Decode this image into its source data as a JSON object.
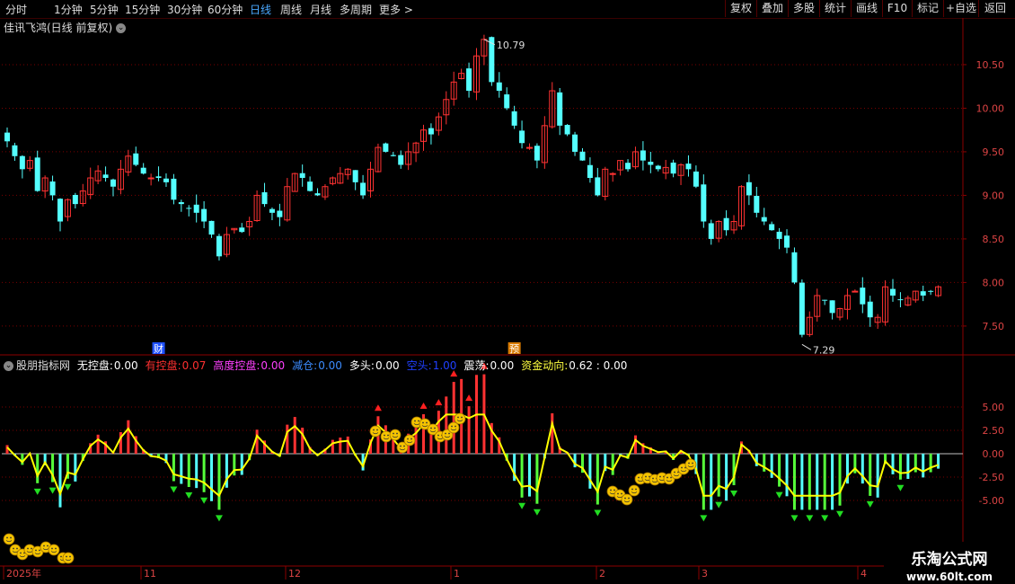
{
  "toolbar": {
    "periods": [
      "分时",
      "1分钟",
      "5分钟",
      "15分钟",
      "30分钟",
      "60分钟",
      "日线",
      "周线",
      "月线",
      "多周期",
      "更多 >"
    ],
    "active_period": "日线",
    "buttons": [
      "复权",
      "叠加",
      "多股",
      "统计",
      "画线",
      "F10",
      "标记",
      "+自选",
      "返回"
    ]
  },
  "main_chart": {
    "title": "佳讯飞鸿(日线 前复权)",
    "high_label": "10.79",
    "low_label": "7.29",
    "price_ticks": [
      "10.50",
      "10.00",
      "9.50",
      "9.00",
      "8.50",
      "8.00",
      "7.50"
    ],
    "markers": {
      "cai": "财",
      "yu": "预"
    }
  },
  "indicator": {
    "name": "股朋指标网",
    "items": [
      {
        "label": "无控盘",
        "value": "0.00",
        "color": "#ffffff"
      },
      {
        "label": "有控盘",
        "value": "0.07",
        "color": "#ff3030"
      },
      {
        "label": "高度控盘",
        "value": "0.00",
        "color": "#ff40ff"
      },
      {
        "label": "减仓",
        "value": "0.00",
        "color": "#3c8cff"
      },
      {
        "label": "多头",
        "value": "0.00",
        "color": "#ffffff"
      },
      {
        "label": "空头",
        "value": "1.00",
        "color": "#2040ff"
      },
      {
        "label": "震荡",
        "value": "0.00",
        "color": "#ffffff"
      },
      {
        "label": "资金动向",
        "value": "0.62 : 0.00",
        "color": "#ffff40"
      }
    ],
    "ticks": [
      "5.00",
      "2.50",
      "0.00",
      "-2.50",
      "-5.00"
    ]
  },
  "time_axis": [
    "2025年",
    "11",
    "12",
    "1",
    "2",
    "3",
    "4"
  ],
  "logo": {
    "line1": "乐淘公式网",
    "line2": "www.60lt.com"
  },
  "colors": {
    "up": "#ff3232",
    "down": "#54ffff",
    "grid": "#8b0000",
    "text": "#dddddd",
    "line": "#ffff00"
  },
  "chart_data": {
    "type": "candlestick",
    "y_range": [
      7.2,
      10.85
    ],
    "closes": [
      9.62,
      9.45,
      9.3,
      9.4,
      9.05,
      9.2,
      9.0,
      8.7,
      8.95,
      8.9,
      9.05,
      9.2,
      9.28,
      9.2,
      9.1,
      9.3,
      9.45,
      9.35,
      9.25,
      9.2,
      9.2,
      9.15,
      8.95,
      8.9,
      8.85,
      8.8,
      8.7,
      8.55,
      8.3,
      8.55,
      8.62,
      8.58,
      8.7,
      9.0,
      8.9,
      8.8,
      8.75,
      9.1,
      9.25,
      9.2,
      9.05,
      9.0,
      9.1,
      9.2,
      9.25,
      9.3,
      9.15,
      9.0,
      9.3,
      9.55,
      9.5,
      9.45,
      9.35,
      9.5,
      9.6,
      9.75,
      9.7,
      9.9,
      10.1,
      10.3,
      10.4,
      10.2,
      10.6,
      10.79,
      10.3,
      10.2,
      10.0,
      9.8,
      9.6,
      9.55,
      9.4,
      9.8,
      10.2,
      9.8,
      9.7,
      9.5,
      9.4,
      9.2,
      9.0,
      9.3,
      9.25,
      9.4,
      9.3,
      9.5,
      9.4,
      9.35,
      9.3,
      9.32,
      9.25,
      9.35,
      9.3,
      9.1,
      8.7,
      8.5,
      8.7,
      8.6,
      8.7,
      9.1,
      9.0,
      8.8,
      8.7,
      8.6,
      8.5,
      8.4,
      8.0,
      7.4,
      7.6,
      7.85,
      7.8,
      7.65,
      7.7,
      7.85,
      7.9,
      7.75,
      7.6,
      7.6,
      7.95,
      7.85,
      7.8,
      7.82,
      7.9,
      7.85,
      7.9,
      7.95
    ]
  }
}
